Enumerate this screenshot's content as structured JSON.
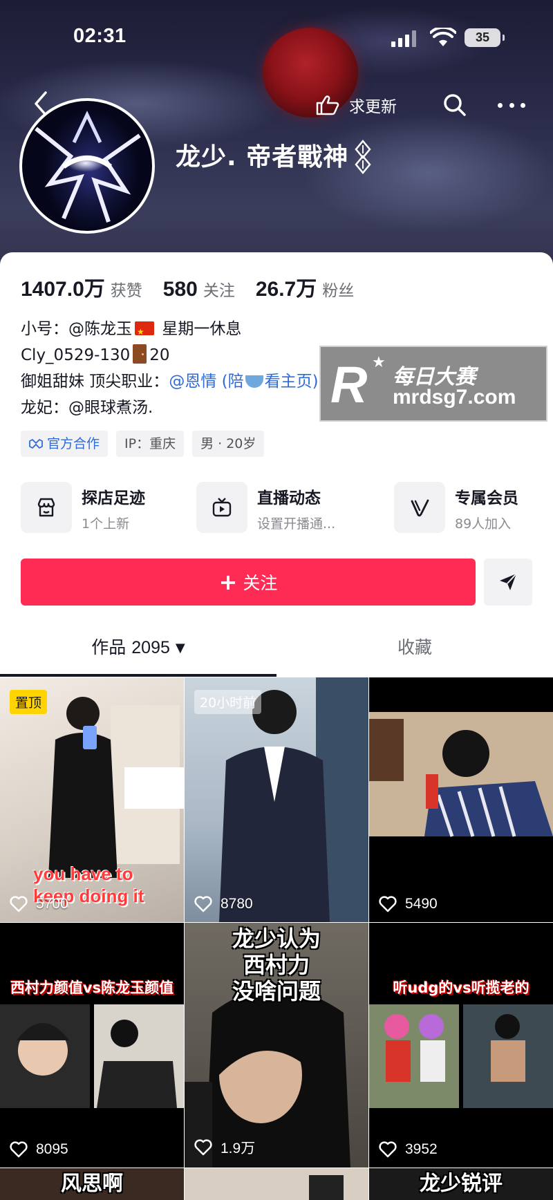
{
  "status_bar": {
    "time": "02:31",
    "battery": "35"
  },
  "header": {
    "update_label": "求更新"
  },
  "profile": {
    "nickname": "龙少. 帝者戰神"
  },
  "stats": [
    {
      "value": "1407.0万",
      "label": "获赞"
    },
    {
      "value": "580",
      "label": "关注"
    },
    {
      "value": "26.7万",
      "label": "粉丝"
    }
  ],
  "bio": {
    "line1_prefix": "小号：",
    "line1_mention": "@陈龙玉",
    "line1_suffix": "星期一休息",
    "line2_prefix": "Cly_0529-130",
    "line2_suffix": "20",
    "line3_prefix": "御姐甜妹 顶尖职业：",
    "line3_mention": "@恩情 (陪",
    "line3_suffix": "看主页)",
    "line4_prefix": "龙妃：",
    "line4_mention": "@眼球煮汤."
  },
  "tags": [
    {
      "label": "官方合作"
    },
    {
      "label": "IP：重庆"
    },
    {
      "label": "男 · 20岁"
    }
  ],
  "watermark": {
    "cn": "每日大赛",
    "url": "mrdsg7.com",
    "letter": "R"
  },
  "services": [
    {
      "title": "探店足迹",
      "sub": "1个上新"
    },
    {
      "title": "直播动态",
      "sub": "设置开播通..."
    },
    {
      "title": "专属会员",
      "sub": "89人加入"
    }
  ],
  "actions": {
    "follow_label": "关注",
    "follow_plus": "+"
  },
  "tabs": {
    "works_label": "作品",
    "works_count": "2095",
    "fav_label": "收藏"
  },
  "videos": [
    {
      "badge": "置顶",
      "caption": "you have to keep doing it",
      "likes": "5700"
    },
    {
      "badge": "20小时前",
      "likes": "8780"
    },
    {
      "likes": "5490"
    },
    {
      "caption": "西村力颜值vs陈龙玉颜值",
      "likes": "8095"
    },
    {
      "caption": "龙少认为 西村力 没啥问题",
      "likes": "1.9万"
    },
    {
      "caption": "听udg的vs听揽老的",
      "likes": "3952"
    },
    {
      "caption": "风思啊"
    },
    {},
    {
      "caption": "龙少锐评"
    }
  ]
}
